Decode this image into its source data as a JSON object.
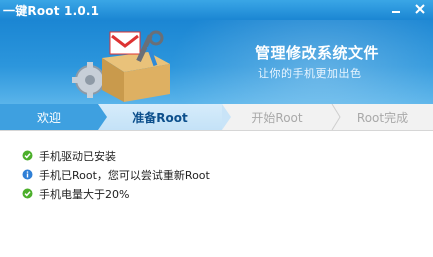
{
  "window": {
    "title": "一键Root 1.0.1",
    "controls": [
      "minimize-icon",
      "close-icon"
    ]
  },
  "banner": {
    "title": "管理修改系统文件",
    "subtitle": "让你的手机更加出色"
  },
  "steps": [
    {
      "label": "欢迎",
      "state": "done"
    },
    {
      "label": "准备Root",
      "state": "current"
    },
    {
      "label": "开始Root",
      "state": "upcoming"
    },
    {
      "label": "Root完成",
      "state": "upcoming"
    }
  ],
  "status_items": [
    {
      "text": "手机驱动已安装",
      "icon": "check-icon",
      "color": "#4caf2b"
    },
    {
      "text": "手机已Root，您可以尝试重新Root",
      "icon": "info-icon",
      "color": "#2f7fd6"
    },
    {
      "text": "手机电量大于20%",
      "icon": "check-icon",
      "color": "#4caf2b"
    }
  ],
  "colors": {
    "titlebar": "#1b86d3",
    "step_done": "#3ea0e0",
    "step_current": "#c9e4f8",
    "step_upcoming_text": "#a9a9a9"
  }
}
